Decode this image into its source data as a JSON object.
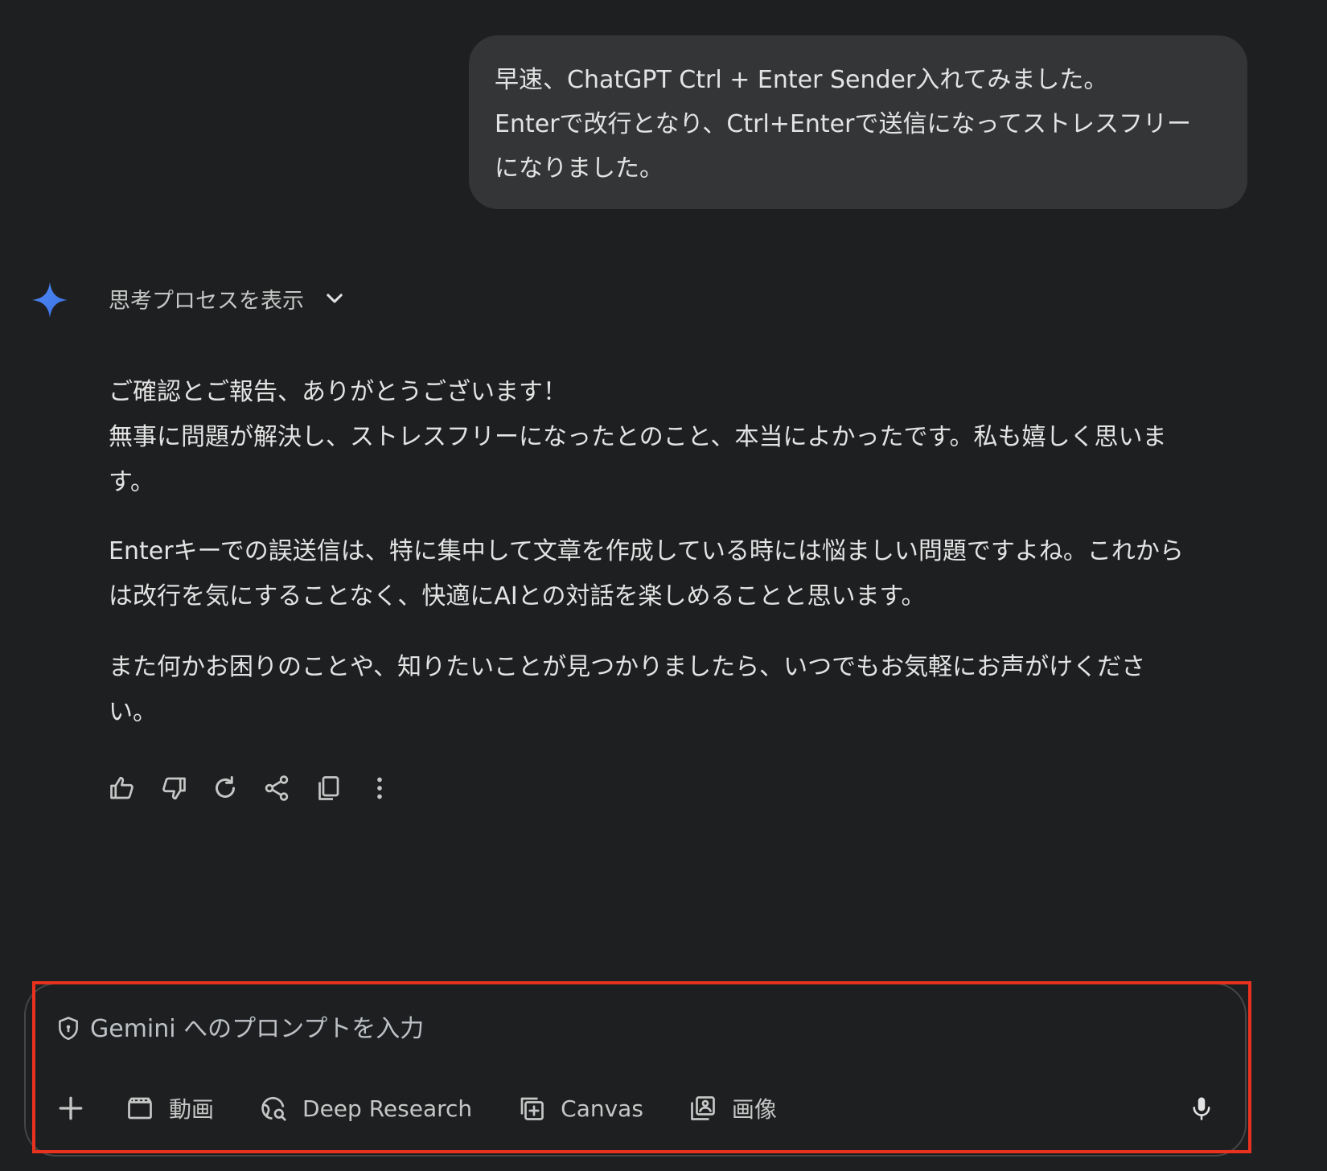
{
  "user_message": {
    "lines": [
      "早速、ChatGPT Ctrl + Enter Sender入れてみました。",
      "Enterで改行となり、Ctrl+Enterで送信になってストレスフリー",
      "になりました。"
    ]
  },
  "response": {
    "thinking_toggle_label": "思考プロセスを表示",
    "paragraphs": [
      {
        "lines": [
          "ご確認とご報告、ありがとうございます！",
          "無事に問題が解決し、ストレスフリーになったとのこと、本当によかったです。私も嬉しく思いま",
          "す。"
        ]
      },
      {
        "lines": [
          "Enterキーでの誤送信は、特に集中して文章を作成している時には悩ましい問題ですよね。これから",
          "は改行を気にすることなく、快適にAIとの対話を楽しめることと思います。"
        ]
      },
      {
        "lines": [
          "また何かお困りのことや、知りたいことが見つかりましたら、いつでもお気軽にお声がけくださ",
          "い。"
        ]
      }
    ],
    "actions": [
      "thumbs-up-icon",
      "thumbs-down-icon",
      "regenerate-icon",
      "share-icon",
      "copy-icon",
      "more-vert-icon"
    ]
  },
  "composer": {
    "placeholder": "Gemini へのプロンプトを入力",
    "tools": [
      {
        "label": "動画",
        "icon": "video-icon"
      },
      {
        "label": "Deep Research",
        "icon": "deep-research-icon"
      },
      {
        "label": "Canvas",
        "icon": "canvas-icon"
      },
      {
        "label": "画像",
        "icon": "image-icon"
      }
    ],
    "highlight_color": "#e8321f"
  },
  "colors": {
    "background": "#1e1f20",
    "bubble": "#333537",
    "text": "#e3e3e3",
    "muted_text": "#c4c7c5",
    "gemini_blue": "#4285f4"
  }
}
